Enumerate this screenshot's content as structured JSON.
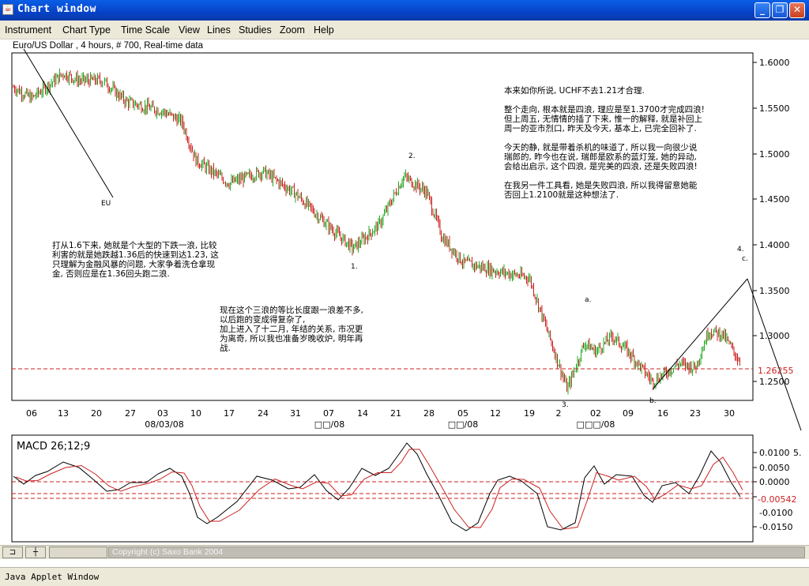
{
  "window": {
    "title": "Chart window",
    "buttons": {
      "minimize": "_",
      "maximize": "❐",
      "close": "✕"
    }
  },
  "menu": {
    "items": [
      "Instrument",
      "Chart Type",
      "Time Scale",
      "View",
      "Lines",
      "Studies",
      "Zoom",
      "Help"
    ]
  },
  "chart": {
    "header": "Euro/US Dollar , 4 hours, # 700, Real-time data",
    "price_axis": [
      "1.6000",
      "1.5500",
      "1.5000",
      "1.4500",
      "1.4000",
      "1.3500",
      "1.3000",
      "1.2500"
    ],
    "current_price": "1.26255",
    "time_ticks": [
      "06",
      "13",
      "20",
      "27",
      "03",
      "10",
      "17",
      "24",
      "31",
      "07",
      "14",
      "21",
      "28",
      "05",
      "12",
      "19",
      "2",
      "02",
      "09",
      "16",
      "23",
      "30"
    ],
    "month_labels": [
      "08/03/08",
      "□□/08",
      "□□/08",
      "□□□/08"
    ],
    "wave_labels": {
      "eu": "EU",
      "w1": "1.",
      "w2": "2.",
      "w3": "3.",
      "wa": "a.",
      "wb": "b.",
      "wc": "c.",
      "w4": "4.",
      "w5": "5."
    },
    "colors": {
      "up": "#22aa22",
      "down": "#cc2222",
      "line": "#000000",
      "dashed": "#cc2222"
    }
  },
  "macd": {
    "label": "MACD 26;12;9",
    "axis": [
      "0.0100",
      "0.0050",
      "0.0000",
      "-0.0050",
      "-0.0100",
      "-0.0150"
    ],
    "current": "-0.00542",
    "colors": {
      "macd": "#000000",
      "signal": "#cc2222"
    }
  },
  "notes": {
    "left": [
      "打从1.6下来, 她就是个大型的下跌一浪, 比较",
      "利害的就是她跌越1.36后的快速到达1.23, 这",
      "只理解为金融风暴的问题, 大家争着洗仓拿现",
      "金, 否则应是在1.36回头跑二浪."
    ],
    "middle": [
      "现在这个三浪的等比长度跟一浪差不多,",
      "以后跑的变成得复杂了,",
      "加上进入了十二月, 年结的关系, 市况更",
      "为离奇, 所以我也准备岁晚收炉, 明年再",
      "战."
    ],
    "right": [
      "本来如你所说, UCHF不去1.21才合理.",
      "",
      "整个走向, 根本就是四浪, 理应是至1.3700才完成四浪!",
      "但上周五, 无情情的插了下来, 惟一的解释, 就是补回上",
      "周一的亚市烈口, 昨天及今天, 基本上, 已完全回补了.",
      "",
      "今天的静, 就是带着杀机的味道了, 所以我一向很少说",
      "瑞郎的, 昨今也在说, 瑞郎是欧系的蓝灯笼, 她的异动,",
      "会给出启示, 这个四浪, 是完美的四浪, 还是失败四浪!",
      "",
      "在我另一件工具看, 她是失败四浪, 所以我得留意她能",
      "否回上1.2100就是这种想法了."
    ]
  },
  "footer": {
    "copyright": "Copyright (c) Saxo Bank 2004",
    "status": "Java Applet Window"
  },
  "chart_data": {
    "type": "line",
    "title": "Euro/US Dollar , 4 hours, # 700, Real-time data",
    "series": [
      {
        "name": "",
        "x": [
          "06",
          "13",
          "20",
          "27",
          "03",
          "10",
          "17",
          "24",
          "31",
          "07",
          "14",
          "21",
          "28",
          "05",
          "12",
          "19",
          "2",
          "02",
          "09",
          "16",
          "23",
          "30"
        ],
        "values": [
          1.582,
          1.596,
          1.585,
          1.563,
          1.552,
          1.495,
          1.468,
          1.482,
          1.456,
          1.418,
          1.405,
          1.478,
          1.458,
          1.376,
          1.366,
          1.358,
          1.272,
          1.282,
          1.272,
          1.256,
          1.251,
          1.266
        ]
      }
    ],
    "ylim": [
      1.215,
      1.62
    ],
    "current_value": 1.26255
  }
}
